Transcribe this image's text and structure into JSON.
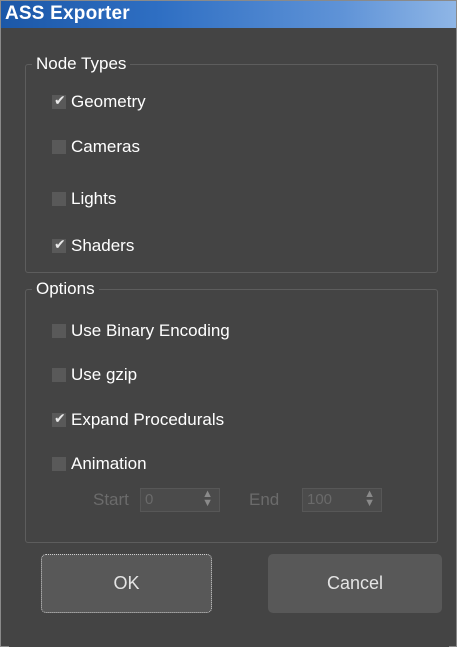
{
  "window": {
    "title": "ASS Exporter"
  },
  "node_types": {
    "legend": "Node Types",
    "items": [
      {
        "label": "Geometry",
        "checked": true
      },
      {
        "label": "Cameras",
        "checked": false
      },
      {
        "label": "Lights",
        "checked": false
      },
      {
        "label": "Shaders",
        "checked": true
      }
    ]
  },
  "options": {
    "legend": "Options",
    "items": [
      {
        "label": "Use Binary Encoding",
        "checked": false
      },
      {
        "label": "Use gzip",
        "checked": false
      },
      {
        "label": "Expand Procedurals",
        "checked": true
      },
      {
        "label": "Animation",
        "checked": false
      }
    ],
    "start_label": "Start",
    "start_value": "0",
    "end_label": "End",
    "end_value": "100"
  },
  "buttons": {
    "ok": "OK",
    "cancel": "Cancel"
  },
  "glyphs": {
    "check": "✔",
    "spin_up": "▲",
    "spin_down": "▼"
  },
  "colors": {
    "title_bar": "#2f6fc3",
    "panel": "#444444",
    "button": "#585858"
  }
}
